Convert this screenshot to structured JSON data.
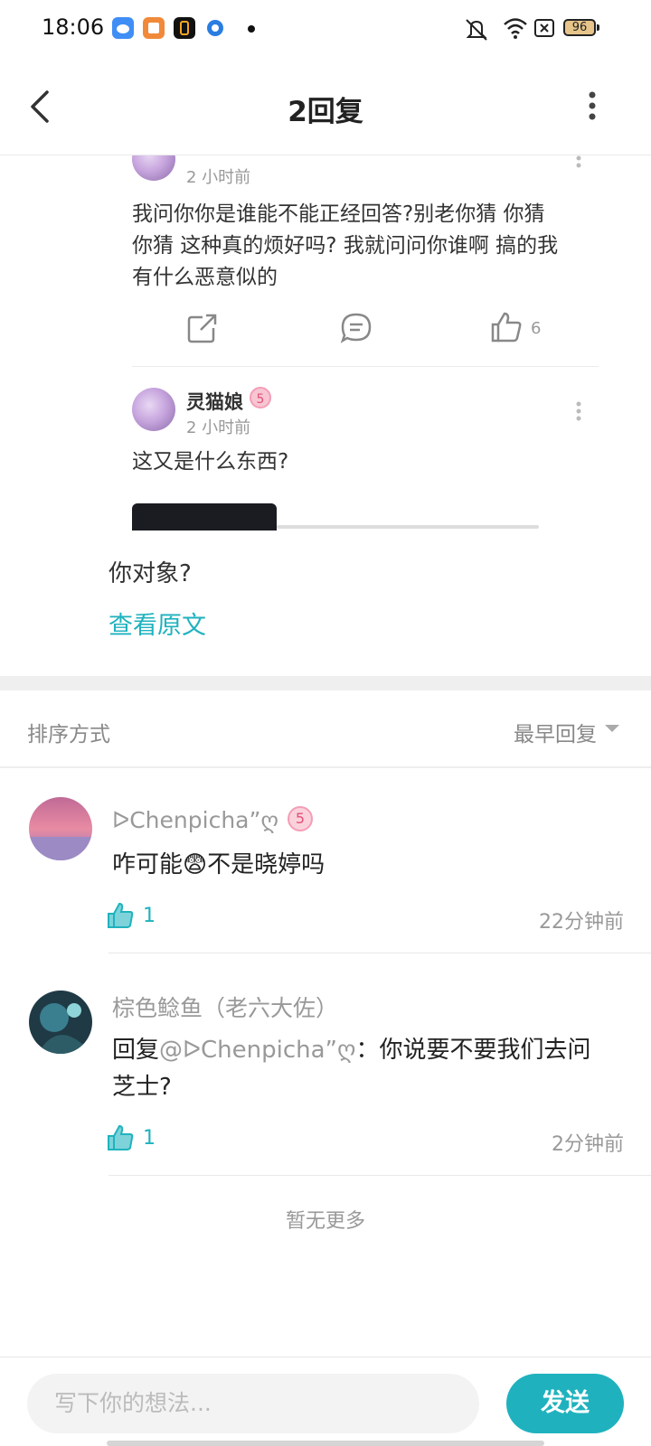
{
  "status_bar": {
    "time": "18:06",
    "battery": "96",
    "icons": [
      "cloud-app-icon",
      "books-app-icon",
      "app-icon",
      "browser-icon",
      "mute-icon",
      "wifi-icon",
      "sim-off-icon",
      "battery-icon"
    ]
  },
  "header": {
    "title": "2回复",
    "back_icon": "chevron-left-icon",
    "more_icon": "more-vertical-icon"
  },
  "quoted": {
    "top_post": {
      "time": "2 小时前",
      "text_lines": [
        "我问你你是谁能不能正经回答?别老你猜 你猜",
        "你猜 这种真的烦好吗? 我就问问你谁啊 搞的我",
        "有什么恶意似的"
      ],
      "like_count": "6",
      "actions": [
        "share-icon",
        "comment-icon",
        "thumb-up-icon"
      ]
    },
    "reply_post": {
      "name": "灵猫娘",
      "badge": "5",
      "time": "2 小时前",
      "text": "这又是什么东西?"
    }
  },
  "reply": {
    "text": "你对象?",
    "view_original": "查看原文"
  },
  "sort": {
    "label": "排序方式",
    "value": "最早回复"
  },
  "comments": [
    {
      "name": "ᐅChenpicha”ღ",
      "badge": "5",
      "body": "咋可能😨不是晓婷吗",
      "likes": "1",
      "time": "22分钟前"
    },
    {
      "name": "棕色鲶鱼（老六大佐）",
      "reply_prefix": "回复",
      "mention": "@ᐅChenpicha”ღ",
      "body_line1": "：你说要不要我们去问",
      "body_line2": "芝士?",
      "likes": "1",
      "time": "2分钟前"
    }
  ],
  "no_more": "暂无更多",
  "input": {
    "placeholder": "写下你的想法...",
    "send_label": "发送"
  },
  "colors": {
    "accent": "#1fb2be",
    "muted_text": "#999999",
    "badge_pink": "#e34f79"
  }
}
